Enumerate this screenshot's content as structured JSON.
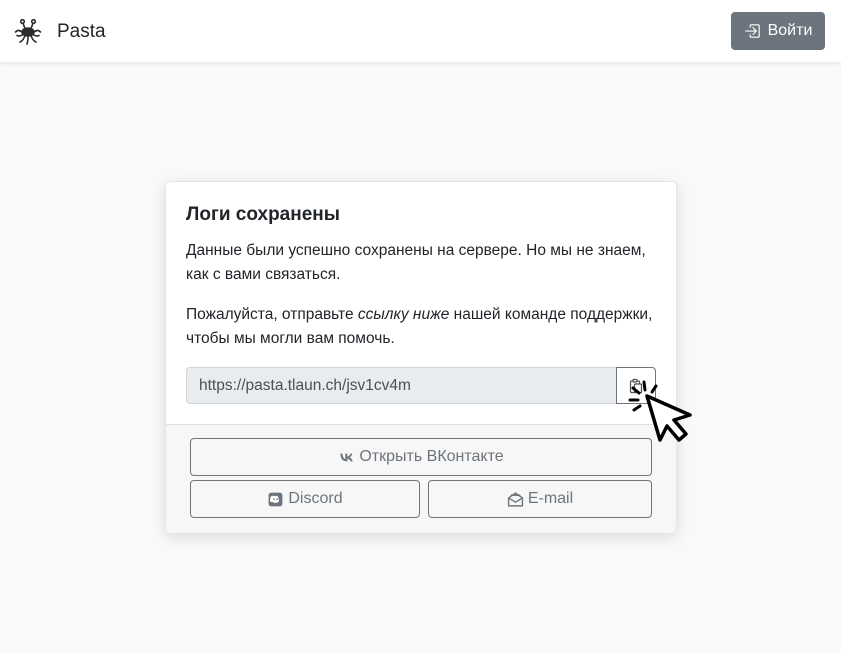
{
  "navbar": {
    "brand_name": "Pasta",
    "brand_icon": "flying-spaghetti-monster-icon",
    "login_label": "Войти",
    "login_icon": "sign-in-icon"
  },
  "card": {
    "title": "Логи сохранены",
    "text1": "Данные были успешно сохранены на сервере. Но мы не знаем, как с вами связаться.",
    "text2_before": "Пожалуйста, отправьте ",
    "text2_em": "ссылку ниже",
    "text2_after": " нашей команде поддержки, чтобы мы могли вам помочь.",
    "link_value": "https://pasta.tlaun.ch/jsv1cv4m",
    "copy_icon": "clipboard-copy-icon"
  },
  "footer": {
    "vk_label": "Открыть ВКонтакте",
    "vk_icon": "vk-icon",
    "discord_label": "Discord",
    "discord_icon": "discord-icon",
    "email_label": "E-mail",
    "email_icon": "envelope-open-icon"
  },
  "colors": {
    "navbar_bg": "#ffffff",
    "page_bg": "#f8f9fa",
    "secondary": "#6c757d",
    "input_bg": "#e9ecef"
  }
}
